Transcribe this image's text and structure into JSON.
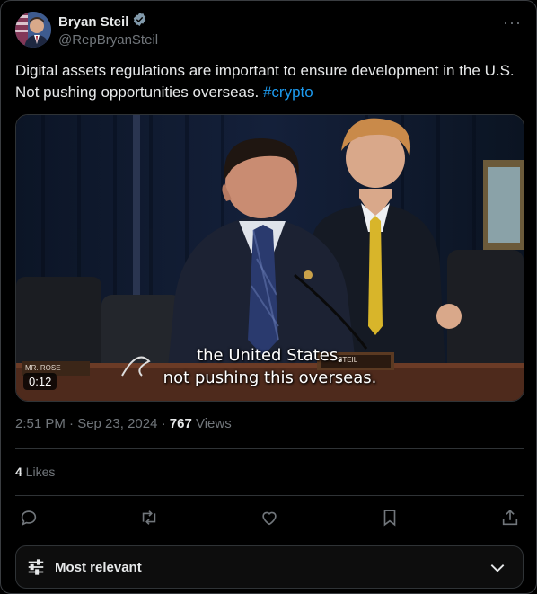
{
  "author": {
    "name": "Bryan Steil",
    "handle": "@RepBryanSteil",
    "verified": true
  },
  "tweet": {
    "text": "Digital assets regulations are important to ensure development in the U.S. Not pushing opportunities overseas. ",
    "hashtag": "#crypto"
  },
  "video": {
    "duration": "0:12",
    "subtitle_line1": "the United States,",
    "subtitle_line2": "not pushing this overseas.",
    "nameplate_left": "MR. ROSE",
    "nameplate_right": "STEIL"
  },
  "meta": {
    "timestamp": "2:51 PM · Sep 23, 2024 · ",
    "views_count": "767",
    "views_label": " Views"
  },
  "likes": {
    "count": "4",
    "label": " Likes"
  },
  "actions": {
    "reply_icon": "reply-icon",
    "retweet_icon": "retweet-icon",
    "like_icon": "heart-icon",
    "bookmark_icon": "bookmark-icon",
    "share_icon": "share-icon"
  },
  "sort": {
    "label": "Most relevant"
  },
  "colors": {
    "background": "#000000",
    "text": "#e7e9ea",
    "muted": "#71767b",
    "accent": "#1d9bf0",
    "border": "#2f3336"
  }
}
